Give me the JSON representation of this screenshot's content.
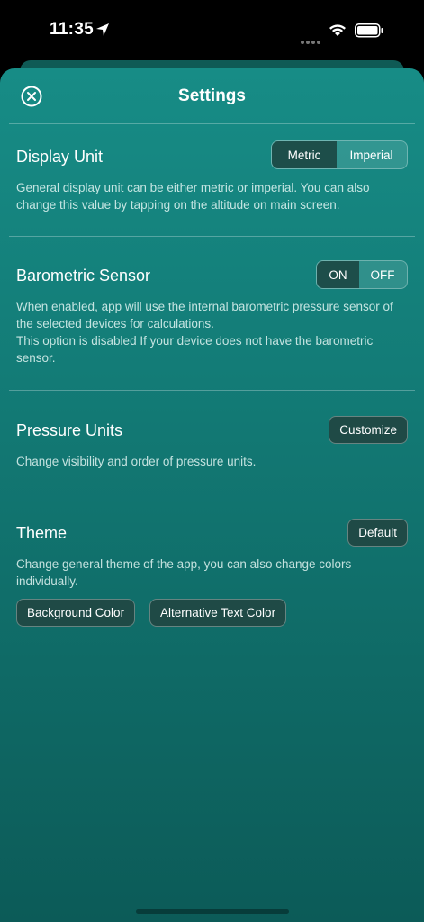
{
  "status": {
    "time": "11:35"
  },
  "header": {
    "title": "Settings"
  },
  "display_unit": {
    "title": "Display Unit",
    "desc": "General display unit can be either metric or imperial. You can also change this value by tapping on the altitude on main screen.",
    "options": [
      "Metric",
      "Imperial"
    ],
    "selected": "Metric"
  },
  "barometric": {
    "title": "Barometric Sensor",
    "desc1": "When enabled, app will use the internal barometric pressure sensor of the selected devices for calculations.",
    "desc2": "This option is disabled If your device does not have the barometric sensor.",
    "options": [
      "ON",
      "OFF"
    ],
    "selected": "ON"
  },
  "pressure": {
    "title": "Pressure Units",
    "desc": "Change visibility and order of pressure units.",
    "button": "Customize"
  },
  "theme": {
    "title": "Theme",
    "desc": "Change general theme of the app, you can also change colors individually.",
    "button": "Default",
    "bg_button": "Background Color",
    "alt_button": "Alternative Text Color"
  },
  "colors": {
    "accent": "#178c86",
    "button_bg": "#1f4a46"
  }
}
